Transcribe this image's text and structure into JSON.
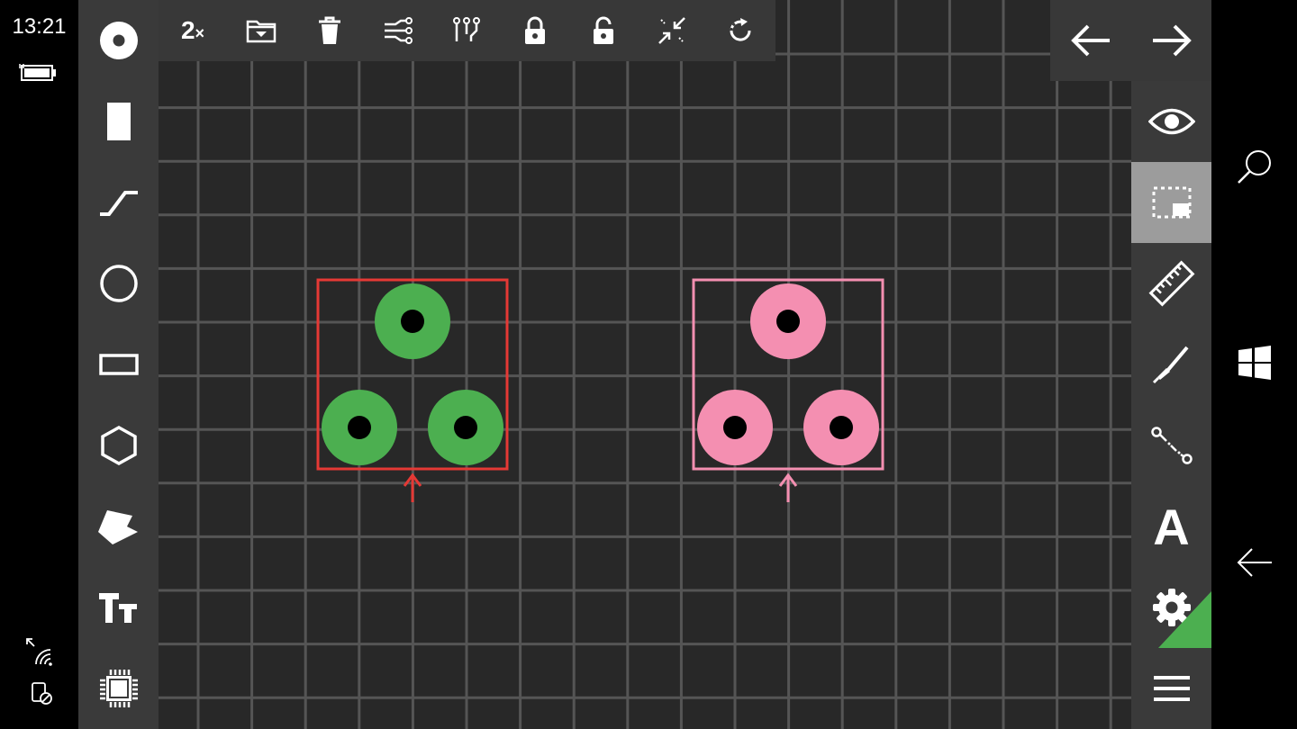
{
  "status": {
    "time": "13:21",
    "battery_icon": "battery-charging-icon",
    "wifi_icon": "wifi-icon",
    "rotation_lock_icon": "rotation-lock-icon"
  },
  "left_toolbar": {
    "items": [
      {
        "name": "pad-tool",
        "icon": "pad-icon"
      },
      {
        "name": "smd-pad-tool",
        "icon": "smd-pad-icon"
      },
      {
        "name": "track-tool",
        "icon": "track-icon"
      },
      {
        "name": "circle-tool",
        "icon": "circle-icon"
      },
      {
        "name": "rectangle-tool",
        "icon": "rectangle-icon"
      },
      {
        "name": "polygon-tool",
        "icon": "hexagon-icon"
      },
      {
        "name": "zone-tool",
        "icon": "zone-icon"
      },
      {
        "name": "text-tool",
        "icon": "text-size-icon",
        "label": "Tт"
      },
      {
        "name": "component-tool",
        "icon": "chip-icon"
      }
    ]
  },
  "top_toolbar": {
    "duplicate_label": "2",
    "duplicate_suffix": "×",
    "items": [
      "duplicate",
      "group",
      "delete",
      "ratsnest",
      "connections",
      "lock",
      "unlock",
      "shrink",
      "rotate"
    ]
  },
  "nav": {
    "back_icon": "arrow-left-icon",
    "forward_icon": "arrow-right-icon"
  },
  "right_toolbar": {
    "items": [
      {
        "name": "visibility",
        "icon": "eye-icon"
      },
      {
        "name": "selection",
        "icon": "select-rectangle-icon",
        "active": true
      },
      {
        "name": "measure",
        "icon": "ruler-icon"
      },
      {
        "name": "draw",
        "icon": "pen-icon"
      },
      {
        "name": "connect",
        "icon": "node-connect-icon"
      },
      {
        "name": "font",
        "icon": "font-icon",
        "label": "A"
      },
      {
        "name": "settings",
        "icon": "gear-icon"
      },
      {
        "name": "menu",
        "icon": "hamburger-icon"
      }
    ]
  },
  "windows_bar": {
    "search_icon": "search-icon",
    "start_icon": "windows-icon",
    "back_icon": "back-arrow-icon"
  },
  "board": {
    "components": [
      {
        "name": "component-selected-red",
        "frame_color": "#e53935",
        "pad_color": "#4caf50",
        "pad_count": 3
      },
      {
        "name": "component-pink",
        "frame_color": "#f48fb1",
        "pad_color": "#f48fb1",
        "pad_count": 3
      }
    ],
    "grid_color": "#555555",
    "background": "#282828"
  }
}
